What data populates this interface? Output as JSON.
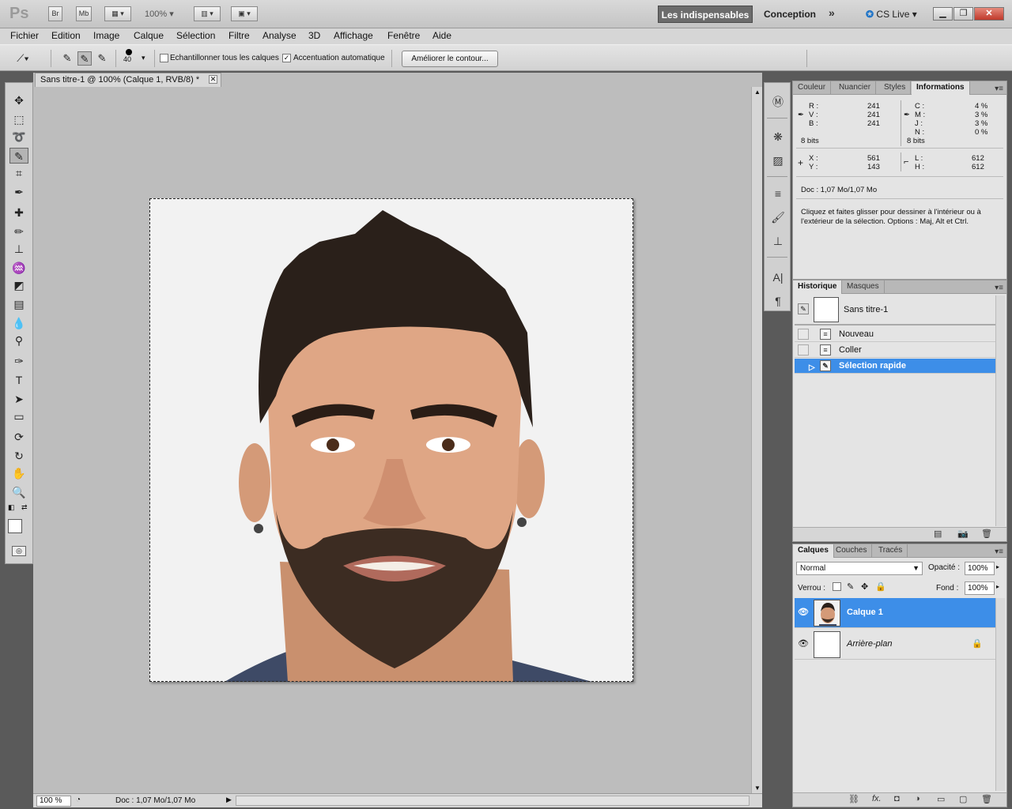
{
  "appbar": {
    "logo": "Ps",
    "bridge": "Br",
    "minibridge": "Mb",
    "zoom": "100%",
    "workspace_active": "Les indispensables",
    "workspace_other": "Conception",
    "more": "»",
    "cslive": "CS Live ▾"
  },
  "menu": [
    "Fichier",
    "Edition",
    "Image",
    "Calque",
    "Sélection",
    "Filtre",
    "Analyse",
    "3D",
    "Affichage",
    "Fenêtre",
    "Aide"
  ],
  "options": {
    "brush_size": "40",
    "sample_all_label": "Echantillonner tous les calques",
    "sample_all_checked": false,
    "auto_enhance_label": "Accentuation automatique",
    "auto_enhance_checked": true,
    "refine_edge_button": "Améliorer le contour..."
  },
  "document": {
    "tab_title": "Sans titre-1 @ 100% (Calque 1, RVB/8) *",
    "zoom": "100 %",
    "doc_size": "Doc : 1,07 Mo/1,07 Mo"
  },
  "info_panel": {
    "tabs": [
      "Couleur",
      "Nuancier",
      "Styles",
      "Informations"
    ],
    "active_tab": "Informations",
    "rgb": {
      "R": "241",
      "V": "241",
      "B": "241"
    },
    "cmyk": {
      "C": "4 %",
      "M": "3 %",
      "J": "3 %",
      "N": "0 %"
    },
    "bits_left": "8 bits",
    "bits_right": "8 bits",
    "X": "561",
    "Y": "143",
    "L": "612",
    "H": "612",
    "doc": "Doc : 1,07 Mo/1,07 Mo",
    "hint": "Cliquez et faites glisser pour dessiner à l'intérieur ou à l'extérieur de la sélection. Options : Maj, Alt et Ctrl."
  },
  "history_panel": {
    "tabs": [
      "Historique",
      "Masques"
    ],
    "snapshot": "Sans titre-1",
    "states": [
      "Nouveau",
      "Coller",
      "Sélection rapide"
    ],
    "selected": "Sélection rapide"
  },
  "layers_panel": {
    "tabs": [
      "Calques",
      "Couches",
      "Tracés"
    ],
    "blend_mode": "Normal",
    "opacity_label": "Opacité :",
    "opacity": "100%",
    "lock_label": "Verrou :",
    "fill_label": "Fond :",
    "fill": "100%",
    "layers": [
      {
        "name": "Calque 1",
        "selected": true,
        "locked": false
      },
      {
        "name": "Arrière-plan",
        "selected": false,
        "locked": true
      }
    ]
  },
  "colors": {
    "selection_blue": "#3d8ee8",
    "workspace_bg": "#bdbdbd",
    "panel_bg": "#e4e4e4"
  }
}
